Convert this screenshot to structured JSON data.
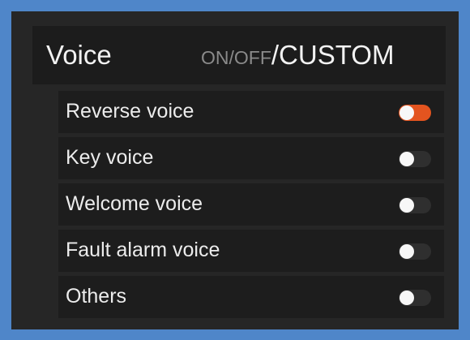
{
  "header": {
    "title": "Voice",
    "mode_dim": "ON/OFF",
    "mode_bright": "/CUSTOM"
  },
  "items": [
    {
      "label": "Reverse voice",
      "on": true
    },
    {
      "label": "Key voice",
      "on": false
    },
    {
      "label": "Welcome voice",
      "on": false
    },
    {
      "label": "Fault alarm voice",
      "on": false
    },
    {
      "label": "Others",
      "on": false
    }
  ],
  "colors": {
    "accent": "#e3541f",
    "frame": "#4f86c9",
    "panel": "#262626"
  }
}
